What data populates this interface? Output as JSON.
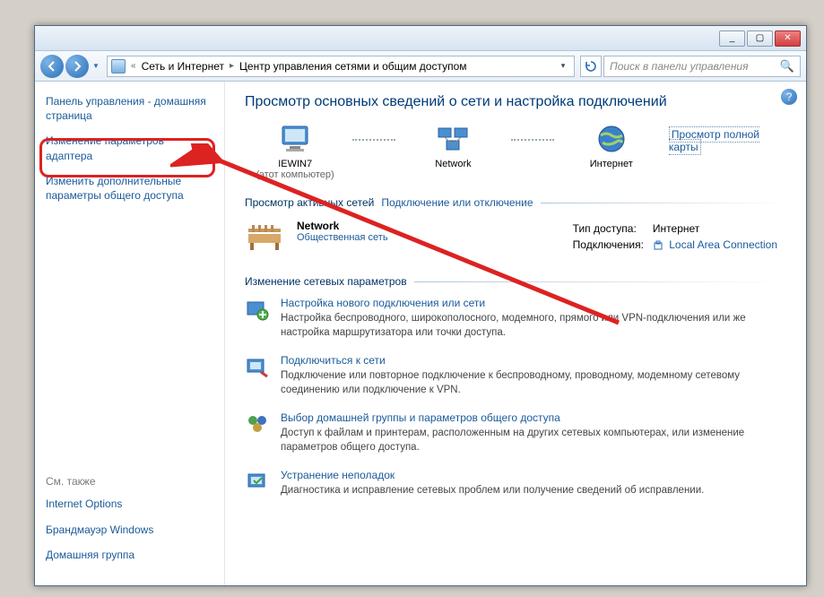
{
  "titlebar": {
    "minimize": "_",
    "maximize": "▢",
    "close": "✕"
  },
  "address": {
    "prefix": "«",
    "seg1": "Сеть и Интернет",
    "seg2": "Центр управления сетями и общим доступом"
  },
  "search": {
    "placeholder": "Поиск в панели управления"
  },
  "sidebar": {
    "home": "Панель управления - домашняя страница",
    "adapter": "Изменение параметров адаптера",
    "sharing": "Изменить дополнительные параметры общего доступа",
    "see_also": "См. также",
    "links": {
      "inetopt": "Internet Options",
      "firewall": "Брандмауэр Windows",
      "homegroup": "Домашняя группа"
    }
  },
  "main": {
    "title": "Просмотр основных сведений о сети и настройка подключений",
    "map": {
      "this_pc": "IEWIN7",
      "this_pc_sub": "(этот компьютер)",
      "network": "Network",
      "internet": "Интернет",
      "full_map": "Просмотр полной карты"
    },
    "active_head": "Просмотр активных сетей",
    "active_toggle": "Подключение или отключение",
    "active": {
      "name": "Network",
      "type": "Общественная сеть",
      "access_label": "Тип доступа:",
      "access_value": "Интернет",
      "conn_label": "Подключения:",
      "conn_value": "Local Area Connection"
    },
    "change_head": "Изменение сетевых параметров",
    "tasks": [
      {
        "title": "Настройка нового подключения или сети",
        "desc": "Настройка беспроводного, широкополосного, модемного, прямого или VPN-подключения или же настройка маршрутизатора или точки доступа."
      },
      {
        "title": "Подключиться к сети",
        "desc": "Подключение или повторное подключение к беспроводному, проводному, модемному сетевому соединению или подключение к VPN."
      },
      {
        "title": "Выбор домашней группы и параметров общего доступа",
        "desc": "Доступ к файлам и принтерам, расположенным на других сетевых компьютерах, или изменение параметров общего доступа."
      },
      {
        "title": "Устранение неполадок",
        "desc": "Диагностика и исправление сетевых проблем или получение сведений об исправлении."
      }
    ]
  }
}
